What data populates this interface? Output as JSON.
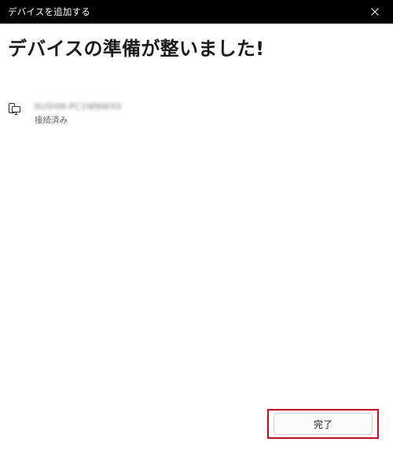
{
  "window": {
    "title": "デバイスを追加する",
    "close_icon": "close-icon"
  },
  "main": {
    "heading": "デバイスの準備が整いました!"
  },
  "device": {
    "icon": "computer-device-icon",
    "name": "KUSHI6-PC1WNWX0",
    "status": "接続済み"
  },
  "footer": {
    "done_label": "完了",
    "highlight_color": "#e4001b"
  }
}
